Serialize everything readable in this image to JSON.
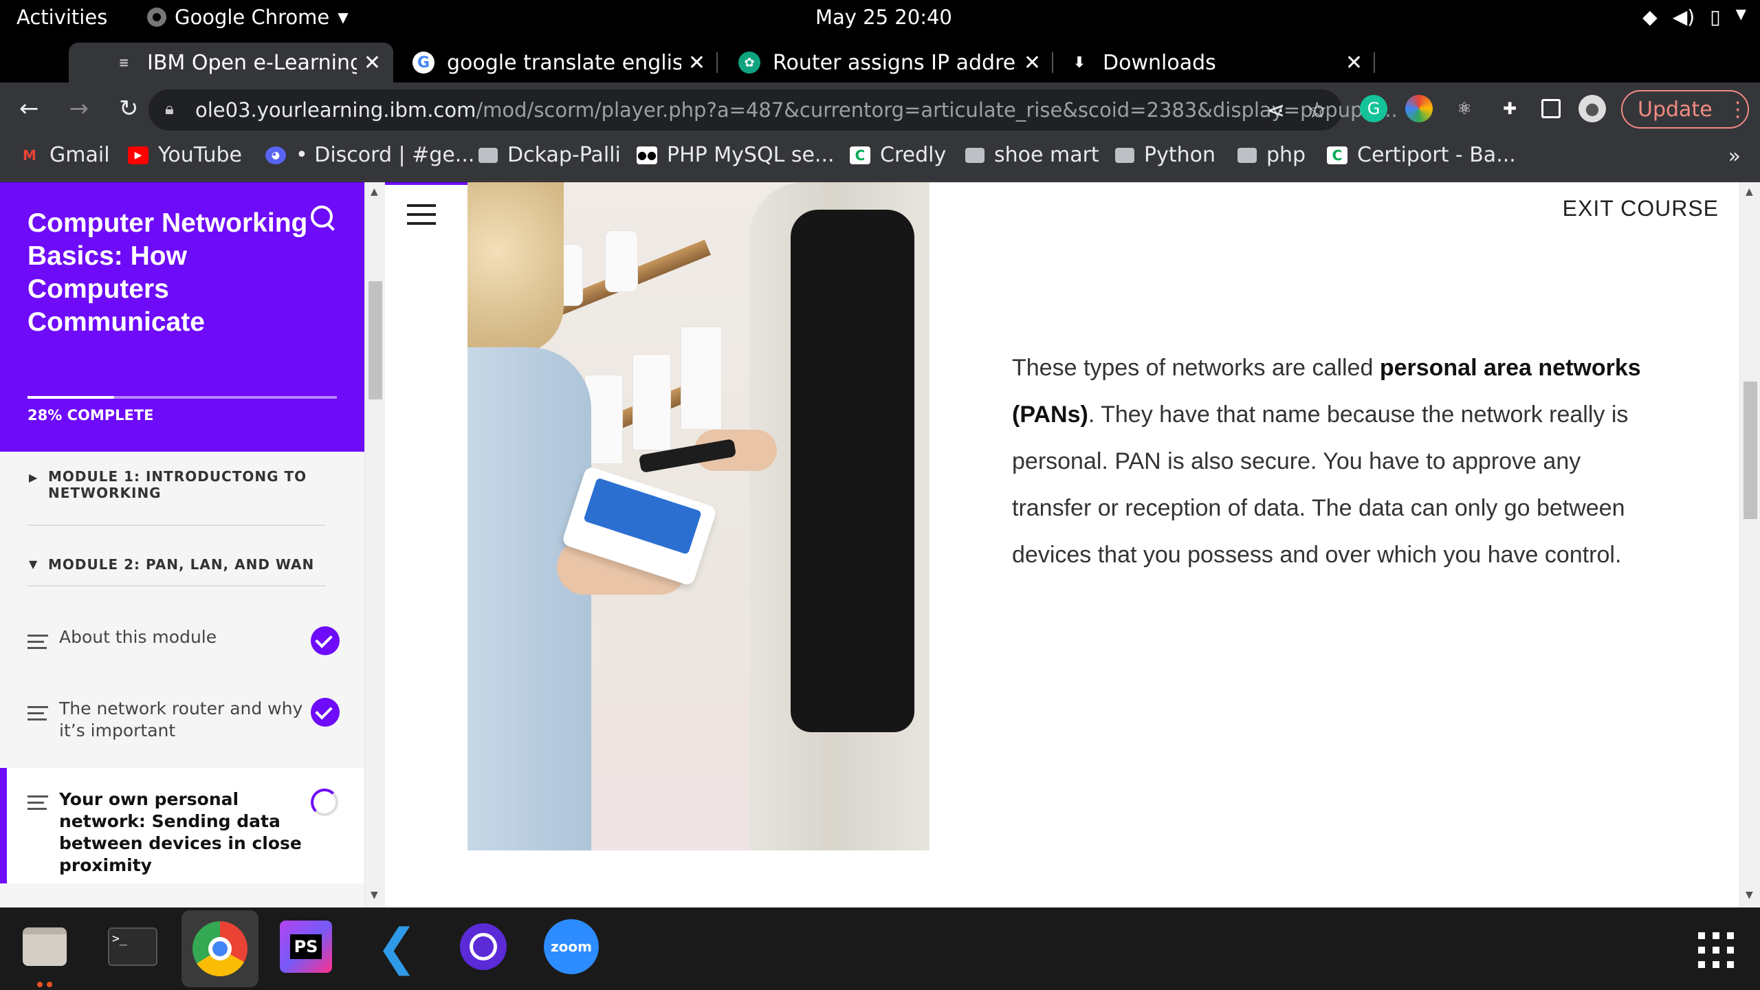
{
  "topbar": {
    "activities": "Activities",
    "app_name": "Google Chrome",
    "clock": "May 25  20:40",
    "tray_icons": [
      "wifi-icon",
      "volume-icon",
      "battery-icon",
      "chevron-down-icon"
    ]
  },
  "tabs": [
    {
      "title": "IBM Open e-Learning Ecos",
      "icon": "ibm-icon",
      "active": true
    },
    {
      "title": "google translate english t",
      "icon": "google-icon",
      "active": false
    },
    {
      "title": "Router assigns IP address",
      "icon": "chatgpt-icon",
      "active": false
    },
    {
      "title": "Downloads",
      "icon": "download-icon",
      "active": false
    }
  ],
  "omnibox": {
    "url_host": "ole03.yourlearning.ibm.com",
    "url_path": "/mod/scorm/player.php?a=487&currentorg=articulate_rise&scoid=2383&display=popup&..."
  },
  "toolbar": {
    "update_label": "Update"
  },
  "bookmarks": [
    {
      "label": "Gmail",
      "icon": "gmail-icon"
    },
    {
      "label": "YouTube",
      "icon": "youtube-icon"
    },
    {
      "label": "• Discord | #ge...",
      "icon": "discord-icon"
    },
    {
      "label": "Dckap-Palli",
      "icon": "folder-icon"
    },
    {
      "label": "PHP MySQL se...",
      "icon": "medium-icon"
    },
    {
      "label": "Credly",
      "icon": "credly-icon"
    },
    {
      "label": "shoe mart",
      "icon": "folder-icon"
    },
    {
      "label": "Python",
      "icon": "folder-icon"
    },
    {
      "label": "php",
      "icon": "folder-icon"
    },
    {
      "label": "Certiport - Ba...",
      "icon": "credly-icon"
    }
  ],
  "course": {
    "title": "Computer Networking Basics: How Computers Communicate",
    "progress_percent": 28,
    "progress_label": "28% COMPLETE",
    "modules": [
      {
        "label": "MODULE 1: INTRODUCTONG TO NETWORKING",
        "expanded": false
      },
      {
        "label": "MODULE 2: PAN, LAN, AND WAN",
        "expanded": true
      }
    ],
    "lessons": [
      {
        "label": "About this module",
        "status": "complete"
      },
      {
        "label": "The network router and why it’s important",
        "status": "complete"
      },
      {
        "label": "Your own personal network: Sending data between devices in close proximity",
        "status": "in-progress"
      }
    ],
    "exit_label": "EXIT COURSE",
    "body": {
      "t1": "These types of networks are called ",
      "b1": "personal area networks (PANs)",
      "t2": ". They have that name because the network really is personal. PAN is also secure. You have to approve any transfer or reception of data. The data can only go between devices that you possess and over which you have control."
    }
  },
  "dock": {
    "apps": [
      "files-icon",
      "terminal-icon",
      "chrome-icon",
      "phpstorm-icon",
      "vscode-icon",
      "screen-recorder-icon",
      "zoom-icon"
    ],
    "zoom_label": "zoom",
    "phpstorm_label": "PS"
  },
  "colors": {
    "accent": "#6e0bf8",
    "chrome_dark": "#35363a",
    "update_red": "#f28b82"
  }
}
